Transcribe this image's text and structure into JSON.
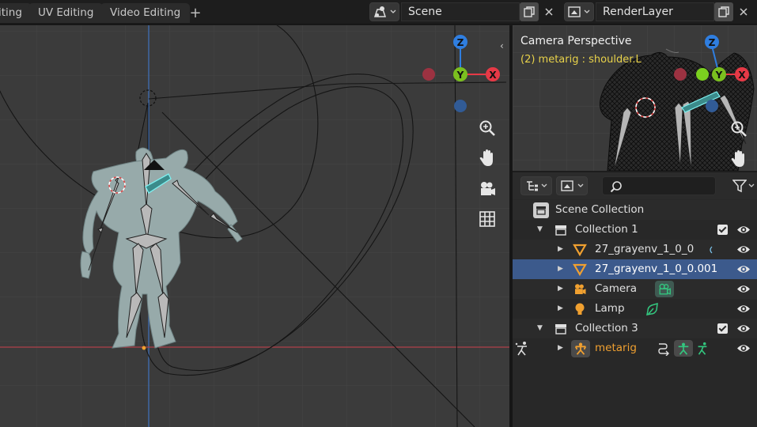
{
  "workspace_tabs": [
    "iting",
    "UV Editing",
    "Video Editing"
  ],
  "add_tab_label": "+",
  "scene": {
    "label": "Scene"
  },
  "render_layer": {
    "label": "RenderLayer"
  },
  "viewport": {
    "gizmo": {
      "z": "Z",
      "y": "Y",
      "x": "X"
    },
    "nav_buttons": [
      "zoom-icon",
      "hand-icon",
      "camera-icon",
      "grid-icon"
    ]
  },
  "camera_view": {
    "title": "Camera Perspective",
    "subtitle": "(2) metarig : shoulder.L",
    "gizmo": {
      "z": "Z",
      "y": "Y",
      "x": "X"
    }
  },
  "outliner": {
    "rows": [
      {
        "label": "Scene Collection",
        "icon": "scene-collection-icon"
      },
      {
        "label": "Collection 1",
        "icon": "collection-icon",
        "checked": true,
        "visible": true
      },
      {
        "label": "27_grayenv_1_0_0",
        "icon": "mesh-icon",
        "visible": true
      },
      {
        "label": "27_grayenv_1_0_0.001",
        "icon": "mesh-icon",
        "visible": true,
        "selected": true
      },
      {
        "label": "Camera",
        "icon": "camera-object-icon",
        "visible": true
      },
      {
        "label": "Lamp",
        "icon": "lamp-icon",
        "visible": true
      },
      {
        "label": "Collection 3",
        "icon": "collection-icon",
        "checked": true,
        "visible": true
      },
      {
        "label": "metarig",
        "icon": "armature-icon",
        "visible": true,
        "active": true
      }
    ]
  },
  "colors": {
    "accent_selected_row": "#3c5a8c",
    "axis_x": "#e63946",
    "axis_y": "#7bbf1f",
    "axis_z": "#2f7ee0",
    "active_object_text": "#f0a030",
    "subtitle_yellow": "#e8d24a"
  }
}
